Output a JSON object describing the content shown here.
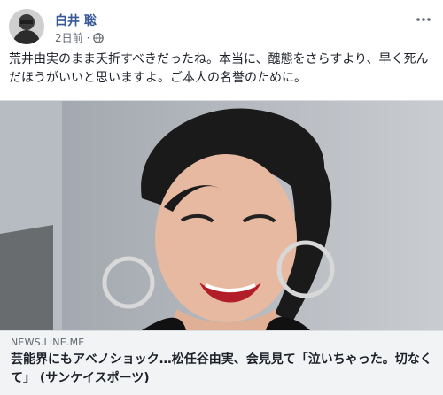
{
  "post": {
    "author": "白井 聡",
    "time": "2日前",
    "privacy_icon": "globe-icon",
    "text": "荒井由実のまま夭折すべきだったね。本当に、醜態をさらすより、早く死んだほうがいいと思いますよ。ご本人の名誉のために。"
  },
  "link": {
    "domain": "NEWS.LINE.ME",
    "title": "芸能界にもアベノショック…松任谷由実、会見見て「泣いちゃった。切なくて」 (サンケイスポーツ)"
  }
}
